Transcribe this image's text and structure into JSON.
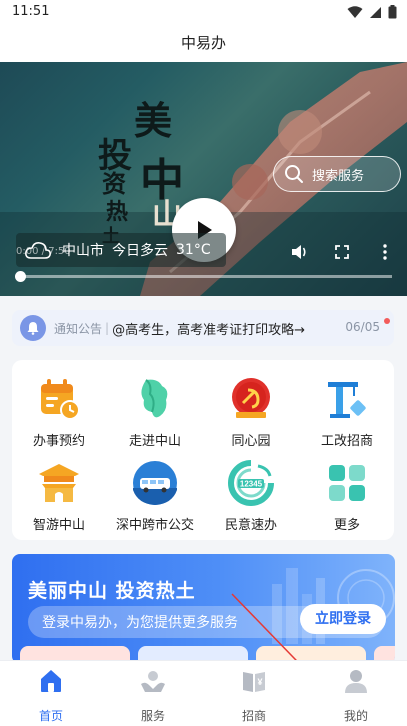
{
  "status_bar": {
    "time": "11:51"
  },
  "header": {
    "title": "中易办"
  },
  "video": {
    "search_placeholder": "搜索服务",
    "weather": {
      "city": "中山市",
      "condition": "今日多云",
      "temperature": "31°C"
    },
    "time_current": "0:00",
    "time_total": "7:50",
    "progress": 0
  },
  "notice": {
    "label": "通知公告",
    "separator": "|",
    "message": "@高考生，高考准考证打印攻略→",
    "date": "06/05"
  },
  "services": [
    {
      "label": "办事预约",
      "icon": "calendar-clock-icon"
    },
    {
      "label": "走进中山",
      "icon": "city-map-icon"
    },
    {
      "label": "同心园",
      "icon": "party-emblem-icon"
    },
    {
      "label": "工改招商",
      "icon": "crane-icon"
    },
    {
      "label": "智游中山",
      "icon": "pagoda-icon"
    },
    {
      "label": "深中跨市公交",
      "icon": "bus-icon"
    },
    {
      "label": "民意速办",
      "icon": "hotline-12345-icon"
    },
    {
      "label": "更多",
      "icon": "more-grid-icon"
    }
  ],
  "banner": {
    "title": "美丽中山 投资热土",
    "login_text": "登录中易办，为您提供更多服务",
    "login_button": "立即登录"
  },
  "tab_bar": {
    "items": [
      {
        "label": "首页",
        "icon": "home-icon",
        "active": true
      },
      {
        "label": "服务",
        "icon": "service-hands-icon",
        "active": false
      },
      {
        "label": "招商",
        "icon": "investment-book-icon",
        "active": false
      },
      {
        "label": "我的",
        "icon": "user-icon",
        "active": false
      }
    ]
  },
  "colors": {
    "accent": "#2f6ff0",
    "orange": "#f5a623",
    "red": "#e0312b",
    "teal": "#39c3b0"
  }
}
